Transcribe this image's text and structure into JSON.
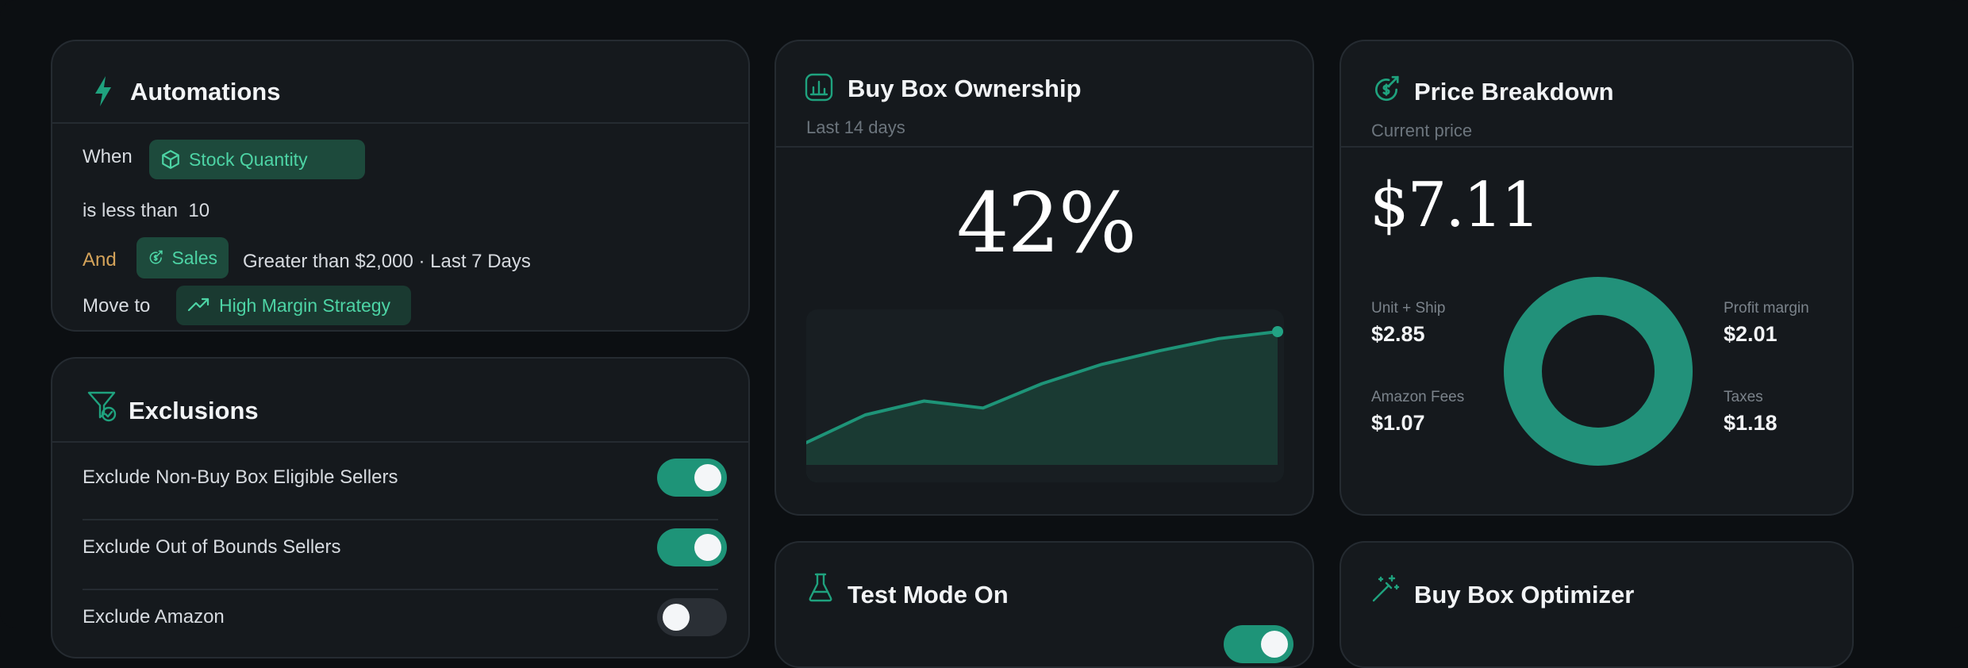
{
  "colors": {
    "accent": "#1e9478",
    "accent_text": "#4dd4a5",
    "and_text": "#d4a35a",
    "background": "#0c0f12",
    "card": "#15191d"
  },
  "automations": {
    "title": "Automations",
    "icon": "bolt-icon",
    "when_label": "When",
    "trigger_chip": "Stock Quantity",
    "condition": "is less than",
    "condition_value": "10",
    "and_label": "And",
    "sales_chip": "Sales",
    "sales_condition": "Greater than $2,000 · Last 7 Days",
    "move_label": "Move to",
    "strategy_chip": "High Margin Strategy"
  },
  "exclusions": {
    "title": "Exclusions",
    "icon": "filter-check-icon",
    "items": [
      {
        "label": "Exclude Non-Buy Box Eligible Sellers",
        "enabled": true
      },
      {
        "label": "Exclude Out of Bounds Sellers",
        "enabled": true
      },
      {
        "label": "Exclude Amazon",
        "enabled": false
      }
    ]
  },
  "buybox_ownership": {
    "title": "Buy Box Ownership",
    "subtitle": "Last 14 days",
    "icon": "bar-chart-icon",
    "value": "42%"
  },
  "chart_data": {
    "type": "area",
    "values": [
      0,
      1.6,
      2.4,
      2.0,
      3.4,
      4.5,
      5.3,
      6.0,
      6.4
    ],
    "title": "",
    "xlabel": "",
    "ylabel": "",
    "grid": false
  },
  "price_breakdown": {
    "title": "Price Breakdown",
    "subtitle": "Current price",
    "icon": "dollar-refresh-icon",
    "price": "$7.11",
    "items": [
      {
        "label": "Unit + Ship",
        "value": "$2.85"
      },
      {
        "label": "Amazon Fees",
        "value": "$1.07"
      },
      {
        "label": "Profit margin",
        "value": "$2.01"
      },
      {
        "label": "Taxes",
        "value": "$1.18"
      }
    ]
  },
  "test_mode": {
    "title": "Test Mode On",
    "icon": "flask-icon"
  },
  "optimizer": {
    "title": "Buy Box Optimizer",
    "icon": "magic-wand-icon"
  }
}
